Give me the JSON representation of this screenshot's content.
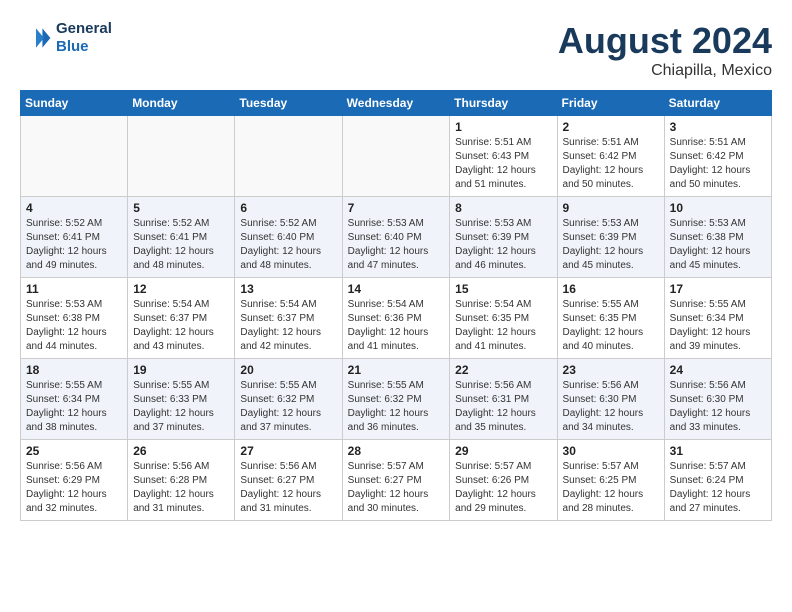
{
  "header": {
    "logo_line1": "General",
    "logo_line2": "Blue",
    "month": "August 2024",
    "location": "Chiapilla, Mexico"
  },
  "days_of_week": [
    "Sunday",
    "Monday",
    "Tuesday",
    "Wednesday",
    "Thursday",
    "Friday",
    "Saturday"
  ],
  "weeks": [
    [
      {
        "day": "",
        "info": ""
      },
      {
        "day": "",
        "info": ""
      },
      {
        "day": "",
        "info": ""
      },
      {
        "day": "",
        "info": ""
      },
      {
        "day": "1",
        "info": "Sunrise: 5:51 AM\nSunset: 6:43 PM\nDaylight: 12 hours\nand 51 minutes."
      },
      {
        "day": "2",
        "info": "Sunrise: 5:51 AM\nSunset: 6:42 PM\nDaylight: 12 hours\nand 50 minutes."
      },
      {
        "day": "3",
        "info": "Sunrise: 5:51 AM\nSunset: 6:42 PM\nDaylight: 12 hours\nand 50 minutes."
      }
    ],
    [
      {
        "day": "4",
        "info": "Sunrise: 5:52 AM\nSunset: 6:41 PM\nDaylight: 12 hours\nand 49 minutes."
      },
      {
        "day": "5",
        "info": "Sunrise: 5:52 AM\nSunset: 6:41 PM\nDaylight: 12 hours\nand 48 minutes."
      },
      {
        "day": "6",
        "info": "Sunrise: 5:52 AM\nSunset: 6:40 PM\nDaylight: 12 hours\nand 48 minutes."
      },
      {
        "day": "7",
        "info": "Sunrise: 5:53 AM\nSunset: 6:40 PM\nDaylight: 12 hours\nand 47 minutes."
      },
      {
        "day": "8",
        "info": "Sunrise: 5:53 AM\nSunset: 6:39 PM\nDaylight: 12 hours\nand 46 minutes."
      },
      {
        "day": "9",
        "info": "Sunrise: 5:53 AM\nSunset: 6:39 PM\nDaylight: 12 hours\nand 45 minutes."
      },
      {
        "day": "10",
        "info": "Sunrise: 5:53 AM\nSunset: 6:38 PM\nDaylight: 12 hours\nand 45 minutes."
      }
    ],
    [
      {
        "day": "11",
        "info": "Sunrise: 5:53 AM\nSunset: 6:38 PM\nDaylight: 12 hours\nand 44 minutes."
      },
      {
        "day": "12",
        "info": "Sunrise: 5:54 AM\nSunset: 6:37 PM\nDaylight: 12 hours\nand 43 minutes."
      },
      {
        "day": "13",
        "info": "Sunrise: 5:54 AM\nSunset: 6:37 PM\nDaylight: 12 hours\nand 42 minutes."
      },
      {
        "day": "14",
        "info": "Sunrise: 5:54 AM\nSunset: 6:36 PM\nDaylight: 12 hours\nand 41 minutes."
      },
      {
        "day": "15",
        "info": "Sunrise: 5:54 AM\nSunset: 6:35 PM\nDaylight: 12 hours\nand 41 minutes."
      },
      {
        "day": "16",
        "info": "Sunrise: 5:55 AM\nSunset: 6:35 PM\nDaylight: 12 hours\nand 40 minutes."
      },
      {
        "day": "17",
        "info": "Sunrise: 5:55 AM\nSunset: 6:34 PM\nDaylight: 12 hours\nand 39 minutes."
      }
    ],
    [
      {
        "day": "18",
        "info": "Sunrise: 5:55 AM\nSunset: 6:34 PM\nDaylight: 12 hours\nand 38 minutes."
      },
      {
        "day": "19",
        "info": "Sunrise: 5:55 AM\nSunset: 6:33 PM\nDaylight: 12 hours\nand 37 minutes."
      },
      {
        "day": "20",
        "info": "Sunrise: 5:55 AM\nSunset: 6:32 PM\nDaylight: 12 hours\nand 37 minutes."
      },
      {
        "day": "21",
        "info": "Sunrise: 5:55 AM\nSunset: 6:32 PM\nDaylight: 12 hours\nand 36 minutes."
      },
      {
        "day": "22",
        "info": "Sunrise: 5:56 AM\nSunset: 6:31 PM\nDaylight: 12 hours\nand 35 minutes."
      },
      {
        "day": "23",
        "info": "Sunrise: 5:56 AM\nSunset: 6:30 PM\nDaylight: 12 hours\nand 34 minutes."
      },
      {
        "day": "24",
        "info": "Sunrise: 5:56 AM\nSunset: 6:30 PM\nDaylight: 12 hours\nand 33 minutes."
      }
    ],
    [
      {
        "day": "25",
        "info": "Sunrise: 5:56 AM\nSunset: 6:29 PM\nDaylight: 12 hours\nand 32 minutes."
      },
      {
        "day": "26",
        "info": "Sunrise: 5:56 AM\nSunset: 6:28 PM\nDaylight: 12 hours\nand 31 minutes."
      },
      {
        "day": "27",
        "info": "Sunrise: 5:56 AM\nSunset: 6:27 PM\nDaylight: 12 hours\nand 31 minutes."
      },
      {
        "day": "28",
        "info": "Sunrise: 5:57 AM\nSunset: 6:27 PM\nDaylight: 12 hours\nand 30 minutes."
      },
      {
        "day": "29",
        "info": "Sunrise: 5:57 AM\nSunset: 6:26 PM\nDaylight: 12 hours\nand 29 minutes."
      },
      {
        "day": "30",
        "info": "Sunrise: 5:57 AM\nSunset: 6:25 PM\nDaylight: 12 hours\nand 28 minutes."
      },
      {
        "day": "31",
        "info": "Sunrise: 5:57 AM\nSunset: 6:24 PM\nDaylight: 12 hours\nand 27 minutes."
      }
    ]
  ]
}
